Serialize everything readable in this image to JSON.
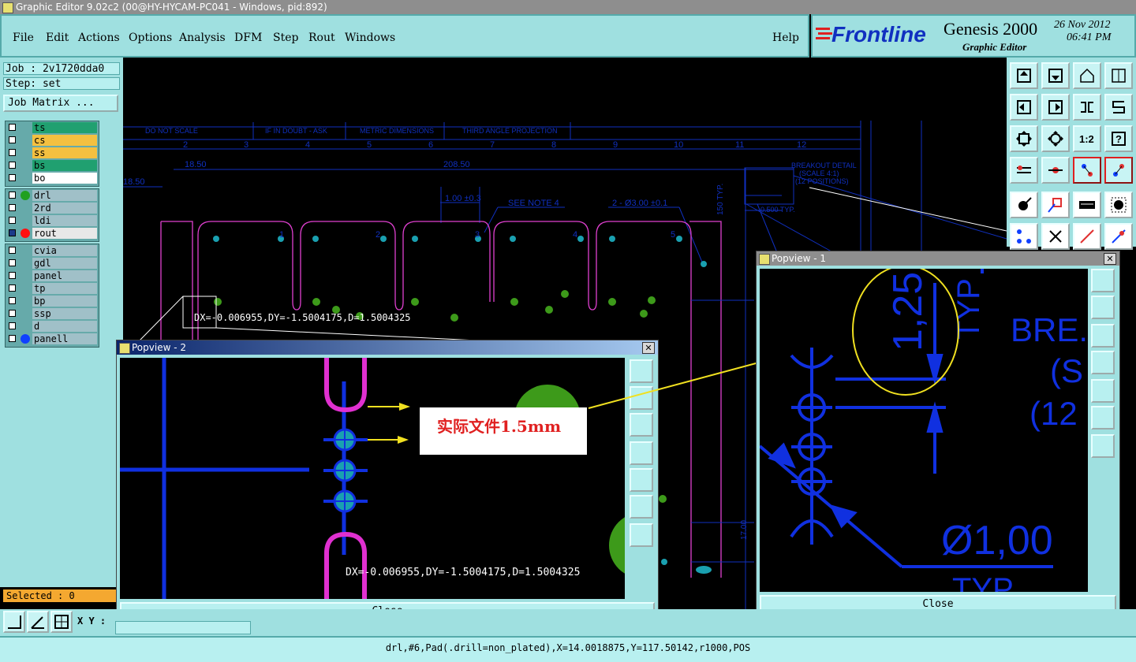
{
  "window": {
    "title": "Graphic Editor 9.02c2 (00@HY-HYCAM-PC041 - Windows, pid:892)"
  },
  "menu": [
    {
      "label": "File"
    },
    {
      "label": "Edit"
    },
    {
      "label": "Actions"
    },
    {
      "label": "Options"
    },
    {
      "label": "Analysis"
    },
    {
      "label": "DFM"
    },
    {
      "label": "Step"
    },
    {
      "label": "Rout"
    },
    {
      "label": "Windows"
    }
  ],
  "help_label": "Help",
  "brand": {
    "logo": "Frontline",
    "product": "Genesis 2000",
    "subtitle": "Graphic Editor",
    "date": "26 Nov 2012",
    "time": "06:41 PM"
  },
  "job": {
    "label": "Job : 2v1720dda0",
    "step": "Step: set",
    "matrix_button": "Job Matrix ..."
  },
  "layers": {
    "group1": [
      {
        "name": "ts",
        "color": "#20a070"
      },
      {
        "name": "cs",
        "color": "#f4c040"
      },
      {
        "name": "ss",
        "color": "#f4c040"
      },
      {
        "name": "bs",
        "color": "#20a070"
      },
      {
        "name": "bo",
        "color": "#ffffff"
      }
    ],
    "group2": [
      {
        "name": "drl",
        "dot": "#20a020",
        "color": "#a0c0c8"
      },
      {
        "name": "2rd",
        "color": "#a0c0c8"
      },
      {
        "name": "ldi",
        "color": "#a0c0c8"
      },
      {
        "name": "rout",
        "dot": "#ff1010",
        "color": "#e8e8e8"
      }
    ],
    "group3": [
      {
        "name": "cvia"
      },
      {
        "name": "gdl"
      },
      {
        "name": "panel"
      },
      {
        "name": "tp"
      },
      {
        "name": "bp"
      },
      {
        "name": "ssp"
      },
      {
        "name": "d"
      },
      {
        "name": "panell",
        "dot": "#1040ff"
      }
    ]
  },
  "selected": "Selected : 0",
  "xy_label": "X Y :",
  "drawing": {
    "header_cells": [
      "DO NOT SCALE",
      "IF IN DOUBT - ASK",
      "METRIC DIMENSIONS",
      "THIRD ANGLE PROJECTION"
    ],
    "column_numbers": [
      "2",
      "3",
      "4",
      "5",
      "6",
      "7",
      "8",
      "9",
      "10",
      "11",
      "12"
    ],
    "dims": {
      "d1": "18.50",
      "d2": "208.50",
      "d3": "18.50",
      "d4": "1.00 ±0.3",
      "note": "SEE NOTE 4",
      "holes": "2 - Ø3.00 ±0.1",
      "typ": "0.500 TYP.",
      "breakout": "BREAKOUT DETAIL",
      "scale": "(SCALE 4:1)",
      "positions": "(12 POSITIONS)",
      "side1": "150 TYP.",
      "side2": "17.00"
    },
    "measure": "DX=-0.006955,DY=-1.5004175,D=1.5004325"
  },
  "popview2": {
    "title": "Popview - 2",
    "measure": "DX=-0.006955,DY=-1.5004175,D=1.5004325",
    "close": "Close"
  },
  "popview1": {
    "title": "Popview - 1",
    "close": "Close",
    "labels": {
      "dim": "1,25",
      "typ": "TYP",
      "bre": "BRE.",
      "s": "(S",
      "twelve": "(12",
      "dia": "Ø1,00",
      "typ2": "TYP"
    }
  },
  "annotation": "实际文件1.5mm",
  "status": "drl,#6,Pad(.drill=non_plated),X=14.0018875,Y=117.50142,r1000,POS"
}
